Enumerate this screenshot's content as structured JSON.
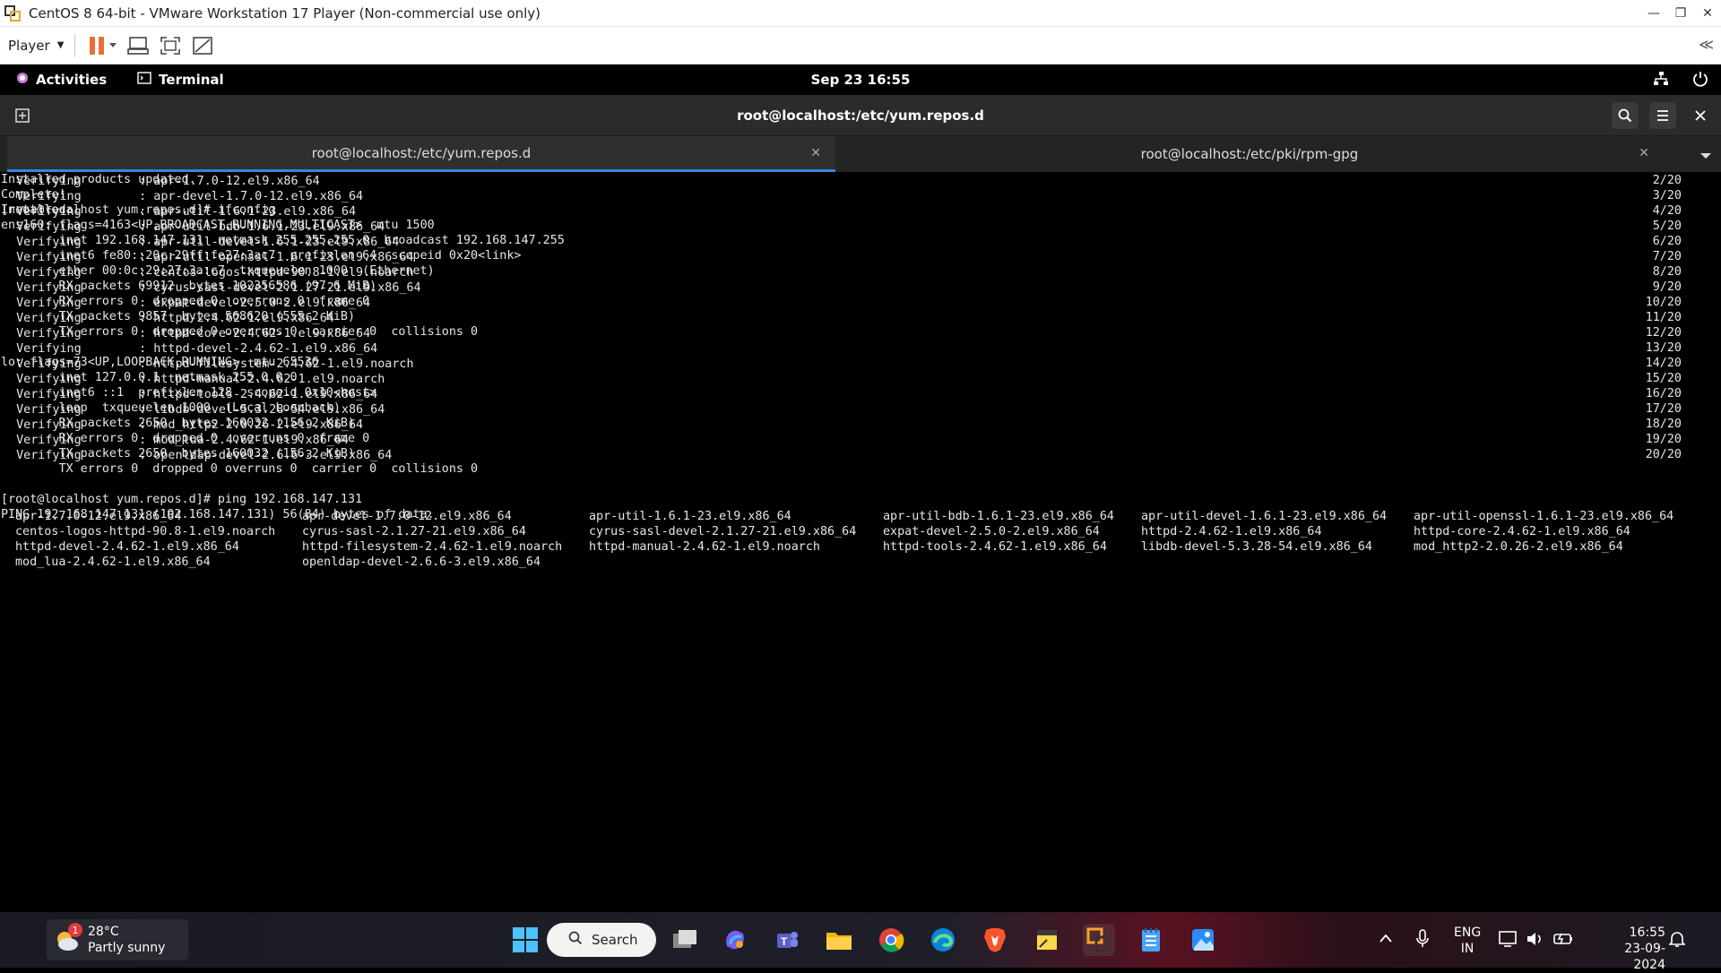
{
  "vmware": {
    "title": "CentOS 8 64-bit - VMware Workstation 17 Player (Non-commercial use only)",
    "player_label": "Player"
  },
  "gnome": {
    "activities": "Activities",
    "app": "Terminal",
    "clock": "Sep 23  16:55"
  },
  "terminal": {
    "window_title": "root@localhost:/etc/yum.repos.d",
    "tabs": [
      {
        "label": "root@localhost:/etc/yum.repos.d",
        "active": true
      },
      {
        "label": "root@localhost:/etc/pki/rpm-gpg",
        "active": false
      }
    ],
    "verifying": [
      {
        "text": "  Verifying        : apr-1.7.0-12.el9.x86_64",
        "count": "2/20"
      },
      {
        "text": "  Verifying        : apr-devel-1.7.0-12.el9.x86_64",
        "count": "3/20"
      },
      {
        "text": "  Verifying        : apr-util-1.6.1-23.el9.x86_64",
        "count": "4/20"
      },
      {
        "text": "  Verifying        : apr-util-bdb-1.6.1-23.el9.x86_64",
        "count": "5/20"
      },
      {
        "text": "  Verifying        : apr-util-devel-1.6.1-23.el9.x86_64",
        "count": "6/20"
      },
      {
        "text": "  Verifying        : apr-util-openssl-1.6.1-23.el9.x86_64",
        "count": "7/20"
      },
      {
        "text": "  Verifying        : centos-logos-httpd-90.8-1.el9.noarch",
        "count": "8/20"
      },
      {
        "text": "  Verifying        : cyrus-sasl-devel-2.1.27-21.el9.x86_64",
        "count": "9/20"
      },
      {
        "text": "  Verifying        : expat-devel-2.5.0-2.el9.x86_64",
        "count": "10/20"
      },
      {
        "text": "  Verifying        : httpd-2.4.62-1.el9.x86_64",
        "count": "11/20"
      },
      {
        "text": "  Verifying        : httpd-core-2.4.62-1.el9.x86_64",
        "count": "12/20"
      },
      {
        "text": "  Verifying        : httpd-devel-2.4.62-1.el9.x86_64",
        "count": "13/20"
      },
      {
        "text": "  Verifying        : httpd-filesystem-2.4.62-1.el9.noarch",
        "count": "14/20"
      },
      {
        "text": "  Verifying        : httpd-manual-2.4.62-1.el9.noarch",
        "count": "15/20"
      },
      {
        "text": "  Verifying        : httpd-tools-2.4.62-1.el9.x86_64",
        "count": "16/20"
      },
      {
        "text": "  Verifying        : libdb-devel-5.3.28-54.el9.x86_64",
        "count": "17/20"
      },
      {
        "text": "  Verifying        : mod_http2-2.0.26-2.el9.x86_64",
        "count": "18/20"
      },
      {
        "text": "  Verifying        : mod_lua-2.4.62-1.el9.x86_64",
        "count": "19/20"
      },
      {
        "text": "  Verifying        : openldap-devel-2.6.6-3.el9.x86_64",
        "count": "20/20"
      }
    ],
    "after_verify": "Installed products updated.\n\nInstalled:",
    "installed": [
      "apr-1.7.0-12.el9.x86_64",
      "apr-devel-1.7.0-12.el9.x86_64",
      "apr-util-1.6.1-23.el9.x86_64",
      "apr-util-bdb-1.6.1-23.el9.x86_64",
      "apr-util-devel-1.6.1-23.el9.x86_64",
      "apr-util-openssl-1.6.1-23.el9.x86_64",
      "centos-logos-httpd-90.8-1.el9.noarch",
      "cyrus-sasl-2.1.27-21.el9.x86_64",
      "cyrus-sasl-devel-2.1.27-21.el9.x86_64",
      "expat-devel-2.5.0-2.el9.x86_64",
      "httpd-2.4.62-1.el9.x86_64",
      "httpd-core-2.4.62-1.el9.x86_64",
      "httpd-devel-2.4.62-1.el9.x86_64",
      "httpd-filesystem-2.4.62-1.el9.noarch",
      "httpd-manual-2.4.62-1.el9.noarch",
      "httpd-tools-2.4.62-1.el9.x86_64",
      "libdb-devel-5.3.28-54.el9.x86_64",
      "mod_http2-2.0.26-2.el9.x86_64",
      "mod_lua-2.4.62-1.el9.x86_64",
      "openldap-devel-2.6.6-3.el9.x86_64",
      "",
      "",
      "",
      ""
    ],
    "rest": "\nComplete!\n[root@localhost yum.repos.d]# ifconfig\nens160: flags=4163<UP,BROADCAST,RUNNING,MULTICAST>  mtu 1500\n        inet 192.168.147.131  netmask 255.255.255.0  broadcast 192.168.147.255\n        inet6 fe80::20c:29ff:fe27:3ac7  prefixlen 64  scopeid 0x20<link>\n        ether 00:0c:29:27:3a:c7  txqueuelen 1000  (Ethernet)\n        RX packets 69912  bytes 102356586 (97.6 MiB)\n        RX errors 0  dropped 0  overruns 0  frame 0\n        TX packets 9857  bytes 568620 (555.2 KiB)\n        TX errors 0  dropped 0 overruns 0  carrier 0  collisions 0\n\nlo: flags=73<UP,LOOPBACK,RUNNING>  mtu 65536\n        inet 127.0.0.1  netmask 255.0.0.0\n        inet6 ::1  prefixlen 128  scopeid 0x10<host>\n        loop  txqueuelen 1000  (Local Loopback)\n        RX packets 2650  bytes 160032 (156.2 KiB)\n        RX errors 0  dropped 0  overruns 0  frame 0\n        TX packets 2650  bytes 160032 (156.2 KiB)\n        TX errors 0  dropped 0 overruns 0  carrier 0  collisions 0\n\n[root@localhost yum.repos.d]# ping 192.168.147.131\nPING 192.168.147.131 (192.168.147.131) 56(84) bytes of data."
  },
  "taskbar": {
    "weather_temp": "28°C",
    "weather_cond": "Partly sunny",
    "weather_badge": "1",
    "search_label": "Search",
    "lang_top": "ENG",
    "lang_bottom": "IN",
    "time": "16:55",
    "date": "23-09-2024"
  },
  "colors": {
    "tab_accent": "#3584e4",
    "pause": "#e8703a"
  }
}
